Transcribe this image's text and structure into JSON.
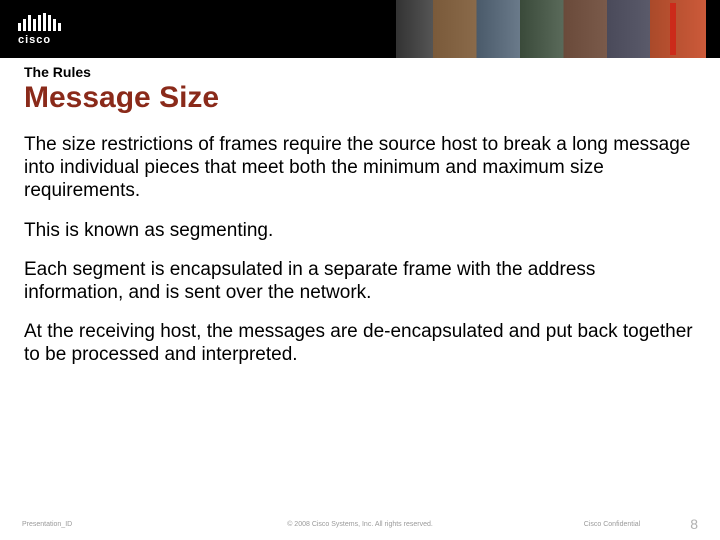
{
  "brand": {
    "name": "cisco"
  },
  "header": {
    "section": "The Rules",
    "title": "Message Size"
  },
  "body": {
    "p1": "The size restrictions of frames require the source host to break a long message into individual pieces that meet both the minimum and maximum size requirements.",
    "p2": "This is known as segmenting.",
    "p3": "Each segment is encapsulated in a separate frame with the address information, and is sent over the network.",
    "p4": "At the receiving host, the messages are de-encapsulated and put back together to be processed and interpreted."
  },
  "footer": {
    "left": "Presentation_ID",
    "center": "© 2008 Cisco Systems, Inc. All rights reserved.",
    "confidential": "Cisco Confidential",
    "page": "8"
  }
}
